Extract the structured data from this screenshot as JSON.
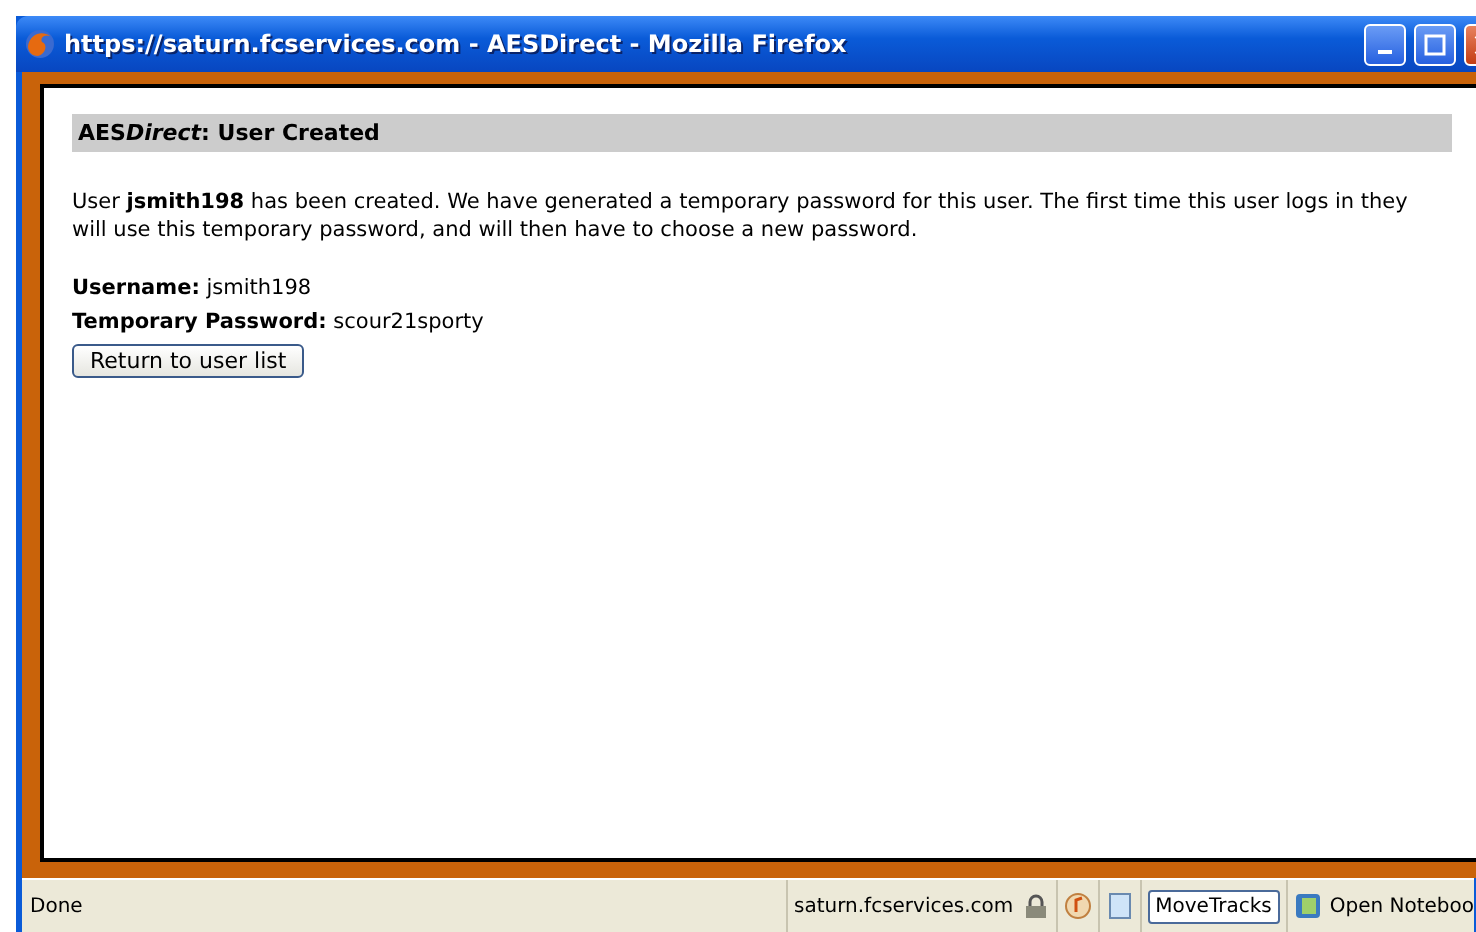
{
  "window": {
    "title": "https://saturn.fcservices.com - AESDirect - Mozilla Firefox"
  },
  "page": {
    "heading": {
      "brand": "AES",
      "brand_italic": "Direct",
      "text": ": User Created"
    },
    "message": "User **jsmith198** has been created. We have generated a temporary password for this user. The first time this user logs in they will use this temporary password, and will then have to choose a new password.",
    "fields": [
      {
        "label": "Username:",
        "value": "jsmith198"
      },
      {
        "label": "Temporary Password:",
        "value": "scour21sporty"
      }
    ],
    "button": "Return to user list"
  },
  "status_bar": {
    "status": "Done",
    "host": "saturn.fcservices.com",
    "move_tracks": "MoveTracks",
    "notebook": "Open Noteboo"
  }
}
